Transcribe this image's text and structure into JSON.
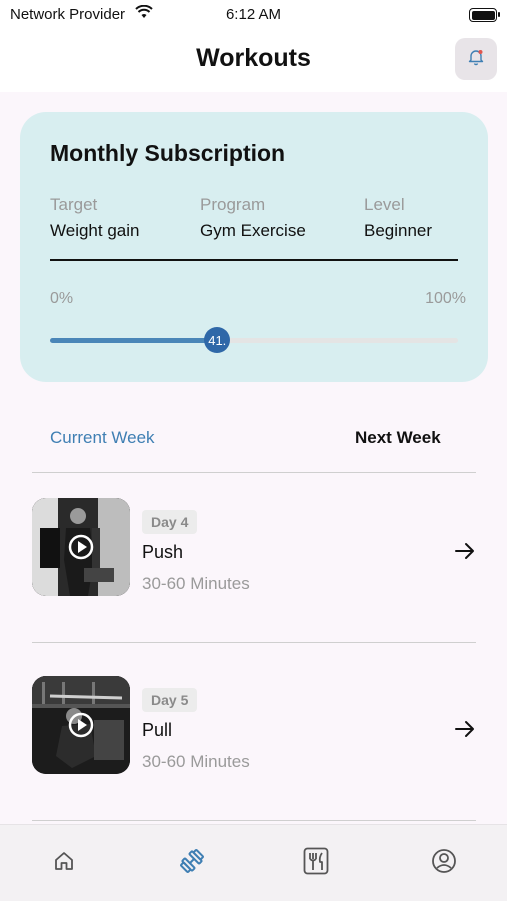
{
  "status_bar": {
    "carrier": "Network Provider",
    "time": "6:12 AM"
  },
  "header": {
    "title": "Workouts"
  },
  "subscription": {
    "title": "Monthly Subscription",
    "target_label": "Target",
    "target_value": "Weight gain",
    "program_label": "Program",
    "program_value": "Gym Exercise",
    "level_label": "Level",
    "level_value": "Beginner",
    "progress_min_label": "0%",
    "progress_max_label": "100%",
    "progress_value": 41,
    "progress_value_label": "41."
  },
  "tabs": {
    "current": "Current Week",
    "next": "Next Week"
  },
  "workouts": [
    {
      "day": "Day 4",
      "name": "Push",
      "duration": "30-60 Minutes"
    },
    {
      "day": "Day 5",
      "name": "Pull",
      "duration": "30-60 Minutes"
    }
  ],
  "nav": [
    "home-icon",
    "dumbbell-icon",
    "fork-knife-icon",
    "profile-icon"
  ],
  "colors": {
    "accent": "#3f7fb3",
    "card_bg": "#d8eef0",
    "slider_thumb": "#2f68a8"
  }
}
